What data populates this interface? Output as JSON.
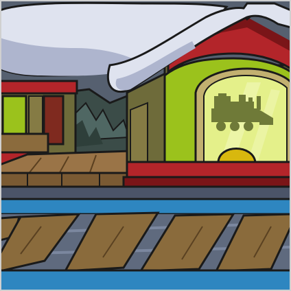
{
  "scene": {
    "sign_icon": "steam-locomotive-icon",
    "colors": {
      "snow": "#dfe3ef",
      "snow_shadow": "#aeb5ce",
      "roof_red": "#b3252a",
      "roof_dark": "#7a1518",
      "wall_olive": "#6e6b3a",
      "window_lime": "#9bc21c",
      "window_glow": "#e4f08a",
      "sign_icon": "#6f7a38",
      "platform_wood": "#9a7447",
      "water": "#2e86c0",
      "track_bed": "#5f6a7e",
      "tie_wood": "#8a6b3c",
      "outline": "#1a1a1a",
      "tree_dark": "#2e3f3a"
    }
  }
}
